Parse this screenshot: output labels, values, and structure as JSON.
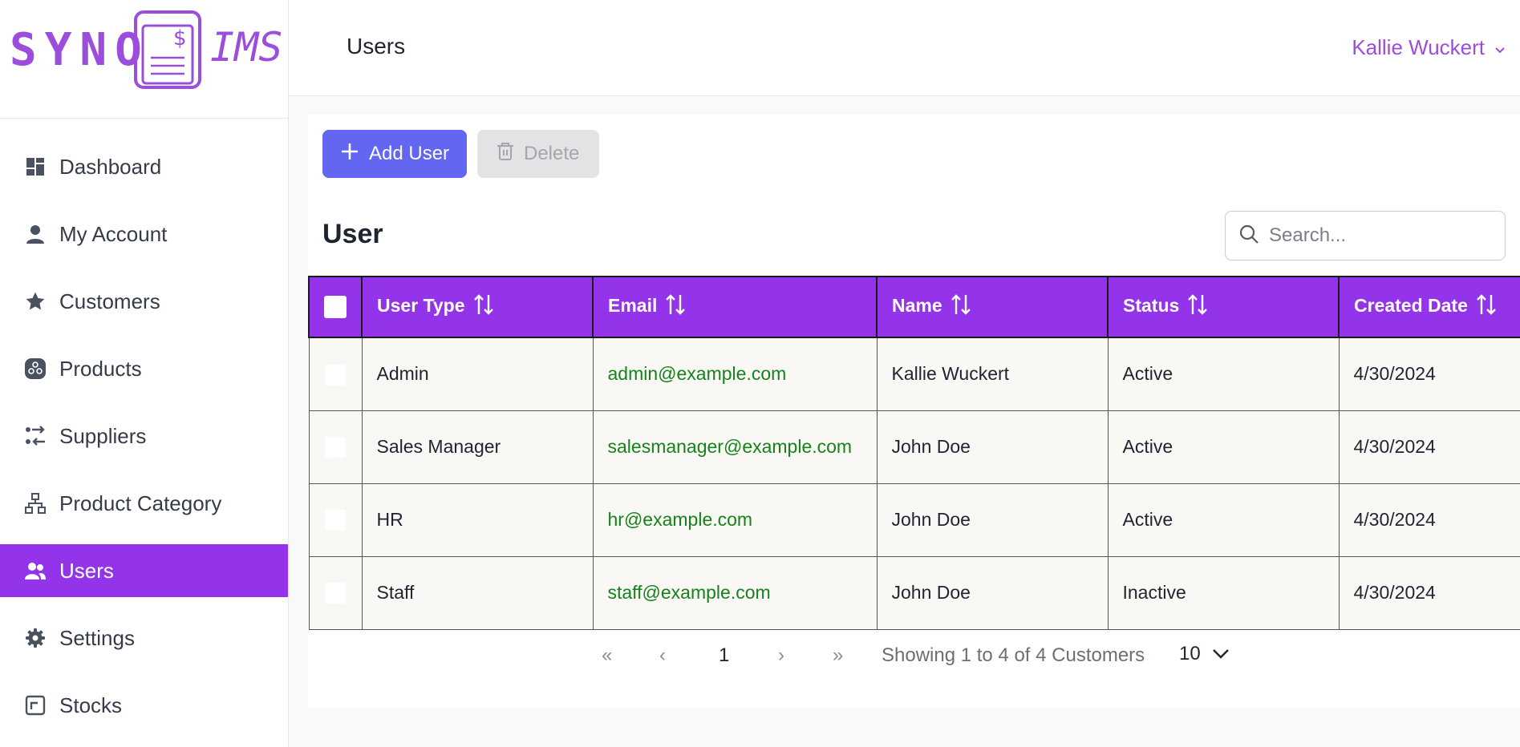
{
  "brand": {
    "left": "SYNO",
    "right": "IMS",
    "doc_symbol": "$",
    "accent": "#9333ea",
    "logo_color": "#9b4ddb"
  },
  "sidebar": {
    "items": [
      {
        "label": "Dashboard",
        "icon": "dashboard-icon",
        "active": false
      },
      {
        "label": "My Account",
        "icon": "user-icon",
        "active": false
      },
      {
        "label": "Customers",
        "icon": "star-icon",
        "active": false
      },
      {
        "label": "Products",
        "icon": "products-icon",
        "active": false
      },
      {
        "label": "Suppliers",
        "icon": "suppliers-icon",
        "active": false
      },
      {
        "label": "Product Category",
        "icon": "sitemap-icon",
        "active": false
      },
      {
        "label": "Users",
        "icon": "users-icon",
        "active": true
      },
      {
        "label": "Settings",
        "icon": "gear-icon",
        "active": false
      },
      {
        "label": "Stocks",
        "icon": "stocks-icon",
        "active": false
      }
    ]
  },
  "header": {
    "title": "Users",
    "user_name": "Kallie Wuckert"
  },
  "toolbar": {
    "add_label": "Add User",
    "delete_label": "Delete"
  },
  "section": {
    "title": "User"
  },
  "search": {
    "placeholder": "Search..."
  },
  "table": {
    "columns": [
      "User Type",
      "Email",
      "Name",
      "Status",
      "Created Date"
    ],
    "rows": [
      {
        "user_type": "Admin",
        "email": "admin@example.com",
        "name": "Kallie Wuckert",
        "status": "Active",
        "created": "4/30/2024"
      },
      {
        "user_type": "Sales Manager",
        "email": "salesmanager@example.com",
        "name": "John Doe",
        "status": "Active",
        "created": "4/30/2024"
      },
      {
        "user_type": "HR",
        "email": "hr@example.com",
        "name": "John Doe",
        "status": "Active",
        "created": "4/30/2024"
      },
      {
        "user_type": "Staff",
        "email": "staff@example.com",
        "name": "John Doe",
        "status": "Inactive",
        "created": "4/30/2024"
      }
    ]
  },
  "pagination": {
    "first": "«",
    "prev": "‹",
    "current_page": "1",
    "next": "›",
    "last": "»",
    "info": "Showing 1 to 4 of 4 Customers",
    "page_size": "10"
  }
}
